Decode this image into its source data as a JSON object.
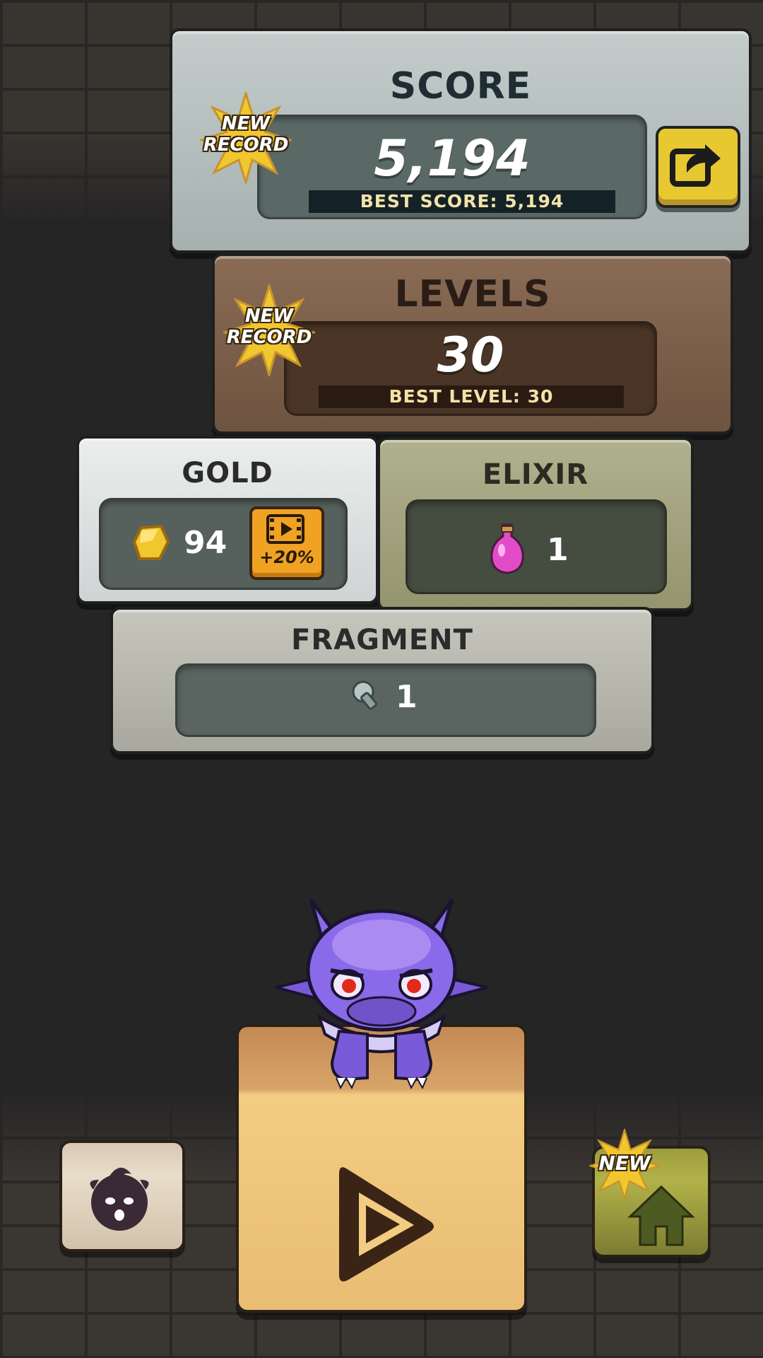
{
  "score_panel": {
    "title": "SCORE",
    "value": "5,194",
    "best_label": "BEST SCORE: 5,194",
    "badge_line1": "NEW",
    "badge_line2": "RECORD"
  },
  "levels_panel": {
    "title": "LEVELS",
    "value": "30",
    "best_label": "BEST LEVEL: 30",
    "badge_line1": "NEW",
    "badge_line2": "RECORD"
  },
  "gold_panel": {
    "title": "GOLD",
    "value": "94",
    "bonus_label": "+20%"
  },
  "elixir_panel": {
    "title": "ELIXIR",
    "value": "1"
  },
  "fragment_panel": {
    "title": "FRAGMENT",
    "value": "1"
  },
  "home_button": {
    "badge": "NEW"
  },
  "icons": {
    "share": "share-icon",
    "video": "video-film-icon",
    "gold": "gold-nugget-icon",
    "elixir": "elixir-potion-icon",
    "fragment": "fragment-bolt-icon",
    "play": "play-icon",
    "home": "home-icon",
    "character": "character-face-icon",
    "monster": "purple-dragon-monster"
  },
  "colors": {
    "score_slab": "#a9b4b2",
    "levels_slab": "#7a5f4a",
    "gold_slab": "#d9dcdc",
    "elixir_slab": "#9e9f7b",
    "fragment_slab": "#b4b4aa",
    "badge_star": "#f2c62e",
    "play_block": "#f0c271",
    "home_block": "#8a8a3a"
  }
}
